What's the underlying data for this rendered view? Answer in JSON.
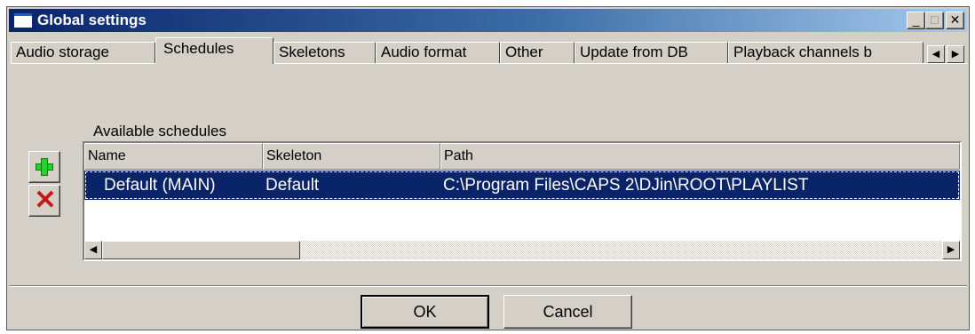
{
  "window": {
    "title": "Global settings",
    "title_bar_color": "#0a246a",
    "minimize_glyph": "_",
    "maximize_glyph": "□",
    "close_glyph": "✕"
  },
  "tabs": [
    {
      "label": "Audio storage",
      "active": false
    },
    {
      "label": "Schedules",
      "active": true
    },
    {
      "label": "Skeletons",
      "active": false
    },
    {
      "label": "Audio format",
      "active": false
    },
    {
      "label": "Other",
      "active": false
    },
    {
      "label": "Update from DB",
      "active": false
    },
    {
      "label": "Playback channels b",
      "active": false
    }
  ],
  "tab_scroll": {
    "left_glyph": "◀",
    "right_glyph": "▶"
  },
  "schedules": {
    "section_label": "Available schedules",
    "add_icon": "plus-icon",
    "delete_icon": "x-icon",
    "add_color": "#22d32d",
    "delete_color": "#c21a1a",
    "columns": [
      "Name",
      "Skeleton",
      "Path"
    ],
    "rows": [
      {
        "name": "Default (MAIN)",
        "skeleton": "Default",
        "path": "C:\\Program Files\\CAPS 2\\DJin\\ROOT\\PLAYLIST",
        "selected": true
      }
    ],
    "selection_color": "#0a246a",
    "scroll_left_glyph": "◀",
    "scroll_right_glyph": "▶"
  },
  "buttons": {
    "ok_label": "OK",
    "cancel_label": "Cancel"
  }
}
